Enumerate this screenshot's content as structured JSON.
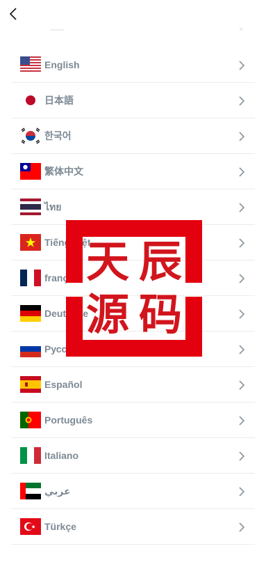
{
  "header": {
    "back_icon": "chevron-left-icon"
  },
  "languages": [
    {
      "label": "English",
      "flag": "us-flag-icon"
    },
    {
      "label": "日本語",
      "flag": "japan-flag-icon"
    },
    {
      "label": "한국어",
      "flag": "korea-flag-icon"
    },
    {
      "label": "繁体中文",
      "flag": "taiwan-flag-icon"
    },
    {
      "label": "ไทย",
      "flag": "thailand-flag-icon"
    },
    {
      "label": "Tiếng Việt",
      "flag": "vietnam-flag-icon"
    },
    {
      "label": "français",
      "flag": "france-flag-icon"
    },
    {
      "label": "Deutsche",
      "flag": "germany-flag-icon"
    },
    {
      "label": "Русский",
      "flag": "russia-flag-icon"
    },
    {
      "label": "Español",
      "flag": "spain-flag-icon"
    },
    {
      "label": "Português",
      "flag": "portugal-flag-icon"
    },
    {
      "label": "Italiano",
      "flag": "italy-flag-icon"
    },
    {
      "label": "عربي",
      "flag": "uae-flag-icon"
    },
    {
      "label": "Türkçe",
      "flag": "turkey-flag-icon"
    }
  ],
  "watermark": {
    "chars": [
      "天",
      "辰",
      "源",
      "码"
    ],
    "color": "#d2151d"
  },
  "colors": {
    "label_text": "#7d8a95",
    "divider": "#ececec",
    "chevron": "#8a949c"
  }
}
